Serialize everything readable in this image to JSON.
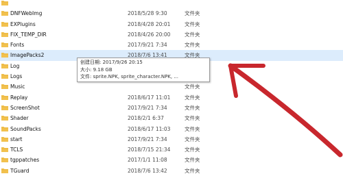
{
  "file_list": {
    "rows": [
      {
        "name": "",
        "date": "",
        "type": ""
      },
      {
        "name": "DNFWebImg",
        "date": "2018/5/28 9:30",
        "type": "文件夹"
      },
      {
        "name": "EXPlugins",
        "date": "2018/4/28 20:01",
        "type": "文件夹"
      },
      {
        "name": "FIX_TEMP_DIR",
        "date": "2018/4/26 20:00",
        "type": "文件夹"
      },
      {
        "name": "Fonts",
        "date": "2017/9/21 7:34",
        "type": "文件夹"
      },
      {
        "name": "ImagePacks2",
        "date": "2018/7/6 13:41",
        "type": "文件夹"
      },
      {
        "name": "Log",
        "date": "",
        "type": "文件夹"
      },
      {
        "name": "Logs",
        "date": "",
        "type": "文件夹"
      },
      {
        "name": "Music",
        "date": "",
        "type": "文件夹"
      },
      {
        "name": "Replay",
        "date": "2018/6/17 11:01",
        "type": "文件夹"
      },
      {
        "name": "ScreenShot",
        "date": "2017/9/21 7:34",
        "type": "文件夹"
      },
      {
        "name": "Shader",
        "date": "2018/2/1 6:37",
        "type": "文件夹"
      },
      {
        "name": "SoundPacks",
        "date": "2018/6/17 11:03",
        "type": "文件夹"
      },
      {
        "name": "start",
        "date": "2017/9/21 7:34",
        "type": "文件夹"
      },
      {
        "name": "TCLS",
        "date": "2018/7/15 21:34",
        "type": "文件夹"
      },
      {
        "name": "tgppatches",
        "date": "2017/1/1 11:08",
        "type": "文件夹"
      },
      {
        "name": "TGuard",
        "date": "2018/7/6 13:42",
        "type": "文件夹"
      }
    ],
    "selected_index": 5
  },
  "tooltip": {
    "created": "创建日期: 2017/9/26 20:15",
    "size": "大小: 9.18 GB",
    "files": "文件: sprite.NPK, sprite_character.NPK, ..."
  },
  "colors": {
    "folder": "#f2c14e",
    "folder_dark": "#d9a12c",
    "selection": "#dcecfc",
    "annotation_arrow": "#c8272d"
  },
  "icons": {
    "row_icon": "folder-icon",
    "annotation": "hand-drawn-arrow"
  }
}
